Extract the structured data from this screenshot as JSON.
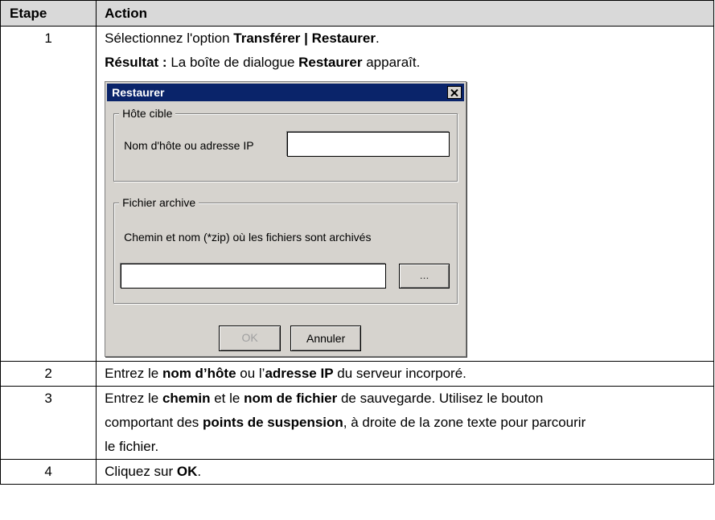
{
  "table": {
    "headers": {
      "step": "Etape",
      "action": "Action"
    },
    "rows": [
      {
        "step": "1",
        "line1": {
          "pre": "Sélectionnez l'option ",
          "bold": "Transférer | Restaurer",
          "post": "."
        },
        "line2": {
          "bold1": "Résultat :",
          "mid": " La boîte de dialogue ",
          "bold2": "Restaurer",
          "post": " apparaît."
        }
      },
      {
        "step": "2",
        "parts": {
          "p1": "Entrez le ",
          "b1": "nom d’hôte",
          "p2": " ou l’",
          "b2": "adresse IP",
          "p3": " du serveur incorporé."
        }
      },
      {
        "step": "3",
        "parts": {
          "p1": "Entrez le ",
          "b1": "chemin",
          "p2": " et le ",
          "b2": "nom de fichier",
          "p3": " de sauvegarde. Utilisez le bouton",
          "l2p1": "comportant des ",
          "l2b1": "points de suspension",
          "l2p2": ", à droite de la zone texte pour parcourir",
          "l3": "le fichier."
        }
      },
      {
        "step": "4",
        "parts": {
          "p1": "Cliquez sur ",
          "b1": "OK",
          "p2": "."
        }
      }
    ]
  },
  "dialog": {
    "title": "Restaurer",
    "host_group": {
      "legend": "Hôte cible",
      "label": "Nom d'hôte ou adresse IP",
      "value": ""
    },
    "file_group": {
      "legend": "Fichier archive",
      "label": "Chemin et nom (*zip) où les fichiers sont archivés",
      "value": "",
      "browse_label": "..."
    },
    "ok_label": "OK",
    "cancel_label": "Annuler"
  }
}
